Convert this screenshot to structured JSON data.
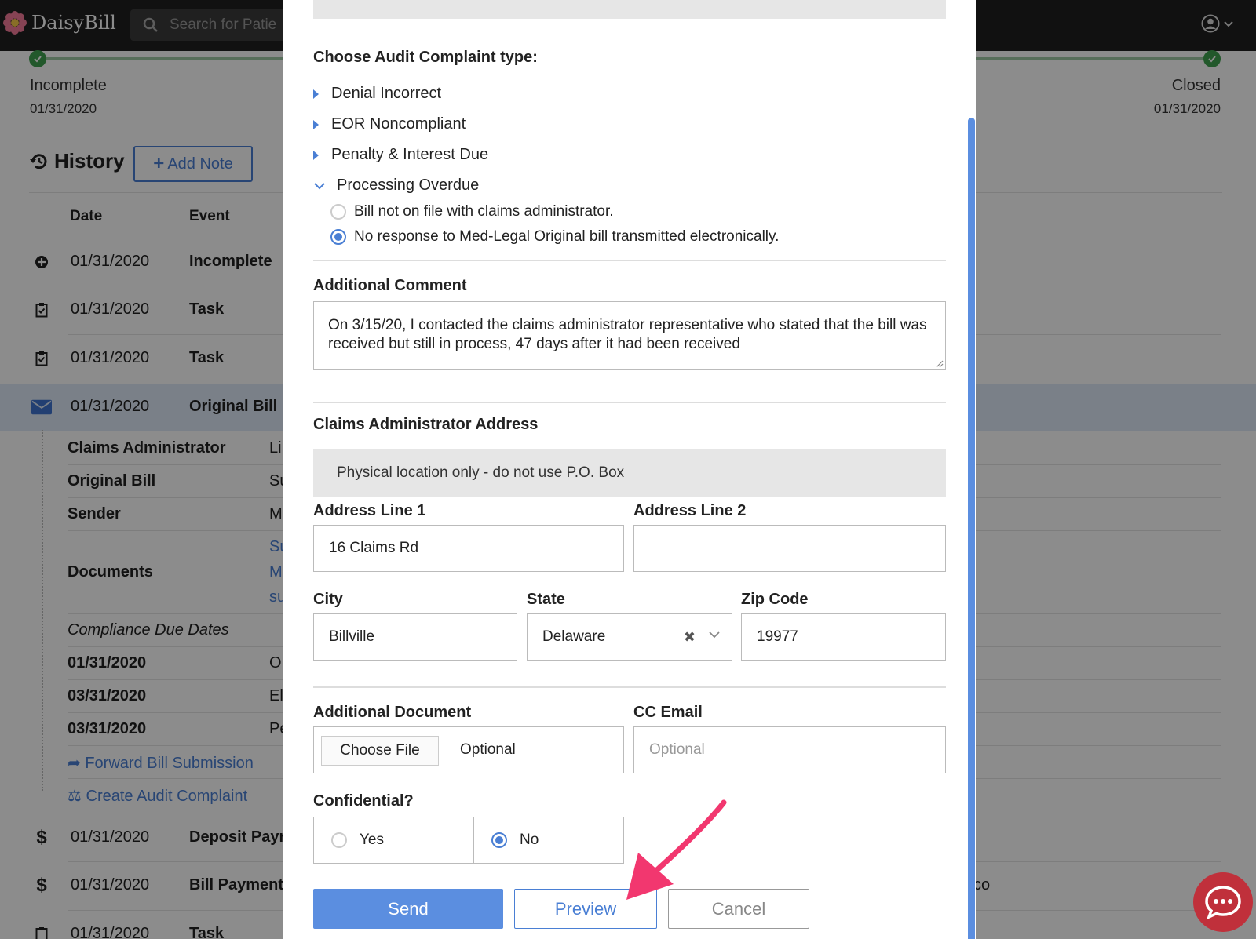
{
  "app": {
    "brand": "DaisyBill",
    "search_placeholder": "Search for Patie"
  },
  "progress": {
    "start_label": "Incomplete",
    "start_date": "01/31/2020",
    "end_label": "Closed",
    "end_date": "01/31/2020"
  },
  "history": {
    "title": "History",
    "add_note_label": "Add Note",
    "col_date": "Date",
    "col_event": "Event",
    "rows": [
      {
        "date": "01/31/2020",
        "event": "Incomplete"
      },
      {
        "date": "01/31/2020",
        "event": "Task"
      },
      {
        "date": "01/31/2020",
        "event": "Task"
      },
      {
        "date": "01/31/2020",
        "event": "Original Bill"
      },
      {
        "date": "01/31/2020",
        "event": "Deposit Payr"
      },
      {
        "date": "01/31/2020",
        "event": "Bill Payment"
      },
      {
        "date": "01/31/2020",
        "event": "Task"
      }
    ],
    "details": {
      "claims_admin_label": "Claims Administrator",
      "claims_admin_value": "Li",
      "original_bill_label": "Original Bill",
      "original_bill_value": "Su",
      "sender_label": "Sender",
      "sender_value": "M",
      "documents_label": "Documents",
      "documents_values": [
        "Su",
        "M",
        "su"
      ],
      "compliance_label": "Compliance Due Dates",
      "compliance_rows": [
        {
          "date": "01/31/2020",
          "value": "O"
        },
        {
          "date": "03/31/2020",
          "value": "El"
        },
        {
          "date": "03/31/2020",
          "value": "Pe"
        }
      ],
      "forward_link": "Forward Bill Submission",
      "audit_link": "Create Audit Complaint"
    },
    "right_trunc": "co"
  },
  "modal": {
    "type_title": "Choose Audit Complaint type:",
    "types": [
      "Denial Incorrect",
      "EOR Noncompliant",
      "Penalty & Interest Due"
    ],
    "expanded_type": "Processing Overdue",
    "options": [
      {
        "label": "Bill not on file with claims administrator.",
        "selected": false
      },
      {
        "label": "No response to Med-Legal Original bill transmitted electronically.",
        "selected": true
      }
    ],
    "comment_label": "Additional Comment",
    "comment_value": "On 3/15/20, I contacted the claims administrator representative who stated that the bill was received but still in process, 47 days after it had been received",
    "address_title": "Claims Administrator Address",
    "address_note": "Physical location only - do not use P.O. Box",
    "address1_label": "Address Line 1",
    "address1_value": "16 Claims Rd",
    "address2_label": "Address Line 2",
    "address2_value": "",
    "city_label": "City",
    "city_value": "Billville",
    "state_label": "State",
    "state_value": "Delaware",
    "zip_label": "Zip Code",
    "zip_value": "19977",
    "doc_label": "Additional Document",
    "choose_file_label": "Choose File",
    "doc_placeholder": "Optional",
    "cc_label": "CC Email",
    "cc_placeholder": "Optional",
    "confidential_label": "Confidential?",
    "yes_label": "Yes",
    "no_label": "No",
    "confidential_selected": "No",
    "send_label": "Send",
    "preview_label": "Preview",
    "cancel_label": "Cancel"
  },
  "colors": {
    "accent": "#4a7fd4",
    "send": "#5b8ee0",
    "annotation_arrow": "#f2376f",
    "chat": "#c0303b",
    "success": "#3fa14f"
  }
}
